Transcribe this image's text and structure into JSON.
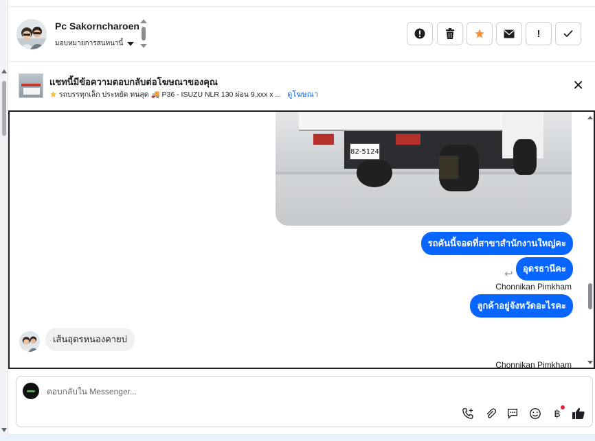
{
  "header": {
    "contact_name": "Pc Sakorncharoen",
    "assign_label": "มอบหมายการสนทนานี้",
    "actions": [
      {
        "name": "spam-button",
        "icon": "exclamation-circle-icon",
        "glyph": "!"
      },
      {
        "name": "delete-button",
        "icon": "trash-icon",
        "glyph": "🗑"
      },
      {
        "name": "star-button",
        "icon": "star-icon",
        "glyph": "★"
      },
      {
        "name": "mark-unread-button",
        "icon": "envelope-icon",
        "glyph": "✉"
      },
      {
        "name": "follow-up-button",
        "icon": "exclamation-icon",
        "glyph": "!"
      },
      {
        "name": "mark-done-button",
        "icon": "check-icon",
        "glyph": "✓"
      }
    ]
  },
  "ad": {
    "title": "แชทนี้มีข้อความตอบกลับต่อโฆษณาของคุณ",
    "subtitle": "รถบรรทุกเล็ก ประหยัด ทนสุด 🚚 P36 - ISUZU NLR 130 ผ่อน 9,xxx x ...",
    "view_ad_link": "ดูโฆษณา",
    "close_icon": "close-icon"
  },
  "chat": {
    "photo_plate": "82-5124",
    "messages_out": [
      {
        "text": "รถคันนี้จอดที่สาขาสำนักงานใหญ่คะ"
      },
      {
        "text": "อุดรธานีคะ"
      },
      {
        "text": "ลูกค้าอยู่จังหวัดอะไรคะ"
      }
    ],
    "sender_1": "Chonnikan Pimkham",
    "sender_2": "Chonnikan Pimkham",
    "message_in": "เส้นอุดรหนองคายบ่"
  },
  "composer": {
    "placeholder": "ตอบกลับใน Messenger...",
    "tools": [
      "call-add-icon",
      "attachment-icon",
      "saved-reply-icon",
      "emoji-icon",
      "payment-icon",
      "like-icon"
    ]
  },
  "colors": {
    "accent": "#0866ff",
    "star": "#f7923b",
    "incoming_bubble": "#f0f0f0"
  }
}
